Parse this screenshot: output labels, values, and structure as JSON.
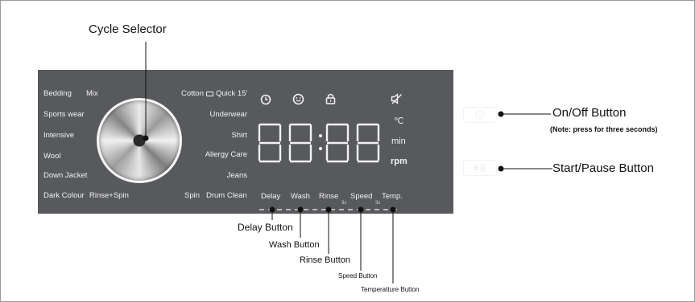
{
  "callouts": {
    "cycle_selector": "Cycle Selector",
    "on_off": "On/Off Button",
    "on_off_note": "(Note: press for three seconds)",
    "start_pause": "Start/Pause Button",
    "delay": "Delay Button",
    "wash": "Wash Button",
    "rinse": "Rinse Button",
    "speed": "Speed Button",
    "temperature": "Temperatture Button"
  },
  "programs_left": [
    "Bedding",
    "Mix",
    "Sports wear",
    "Intensive",
    "Wool",
    "Down Jacket",
    "Dark Colour",
    "Rinse+Spin"
  ],
  "programs_right": [
    "Cotton",
    "Quick 15'",
    "Underwear",
    "Shirt",
    "Allergy Care",
    "Jeans",
    "Spin",
    "Drum Clean"
  ],
  "panel_buttons": [
    "Delay",
    "Wash",
    "Rinse",
    "Speed",
    "Temp."
  ],
  "button_hints": [
    "3s",
    "3s"
  ],
  "display": {
    "digits": "88:88",
    "units": [
      "℃",
      "min",
      "rpm"
    ]
  },
  "icons": [
    "clock-icon",
    "smiley-icon",
    "lock-icon",
    "mute-icon",
    "power-icon",
    "play-pause-icon"
  ],
  "colors": {
    "panel": "#57595c",
    "text": "#f2f2f2"
  }
}
